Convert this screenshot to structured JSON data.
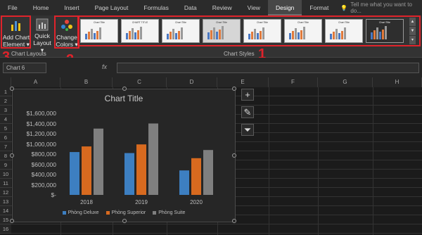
{
  "menu": {
    "items": [
      "File",
      "Home",
      "Insert",
      "Page Layout",
      "Formulas",
      "Data",
      "Review",
      "View",
      "Design",
      "Format"
    ],
    "active": "Design",
    "tellme": "Tell me what you want to do..."
  },
  "ribbon": {
    "add_chart_element": [
      "Add Chart",
      "Element ▾"
    ],
    "quick_layout": [
      "Quick",
      "Layout ▾"
    ],
    "change_colors": [
      "Change",
      "Colors ▾"
    ],
    "group_chart_layouts": "Chart Layouts",
    "group_chart_styles": "Chart Styles",
    "style_thumb_titles": [
      "Chart Title",
      "CHART TITLE",
      "Chart Title",
      "Chart Title",
      "Chart Title",
      "Chart Title",
      "Chart Title",
      "Chart Title"
    ],
    "annotations": [
      "1",
      "2",
      "3"
    ]
  },
  "formula_bar": {
    "name_box": "Chart 6",
    "fx_label": "fx",
    "value": ""
  },
  "grid": {
    "columns": [
      "A",
      "B",
      "C",
      "D",
      "E",
      "F",
      "G",
      "H"
    ],
    "rows": [
      "1",
      "2",
      "3",
      "4",
      "5",
      "6",
      "7",
      "8",
      "9",
      "10",
      "11",
      "12",
      "13",
      "14",
      "15",
      "16"
    ]
  },
  "side_buttons": {
    "add": "+",
    "style": "✎",
    "filter": "⏷"
  },
  "chart_data": {
    "type": "bar",
    "title": "Chart Title",
    "categories": [
      "2018",
      "2019",
      "2020"
    ],
    "series": [
      {
        "name": "Phòng Deluxe",
        "values": [
          840000,
          820000,
          480000
        ],
        "color": "#3d7fc1"
      },
      {
        "name": "Phòng Superior",
        "values": [
          950000,
          990000,
          720000
        ],
        "color": "#d86a1f"
      },
      {
        "name": "Phòng Suite",
        "values": [
          1300000,
          1400000,
          880000
        ],
        "color": "#7f7f7f"
      }
    ],
    "yticks": [
      "$1,600,000",
      "$1,400,000",
      "$1,200,000",
      "$1,000,000",
      "$800,000",
      "$600,000",
      "$400,000",
      "$200,000",
      "$-"
    ],
    "ylim": [
      0,
      1600000
    ],
    "xlabel": "",
    "ylabel": "",
    "legend_position": "bottom"
  }
}
